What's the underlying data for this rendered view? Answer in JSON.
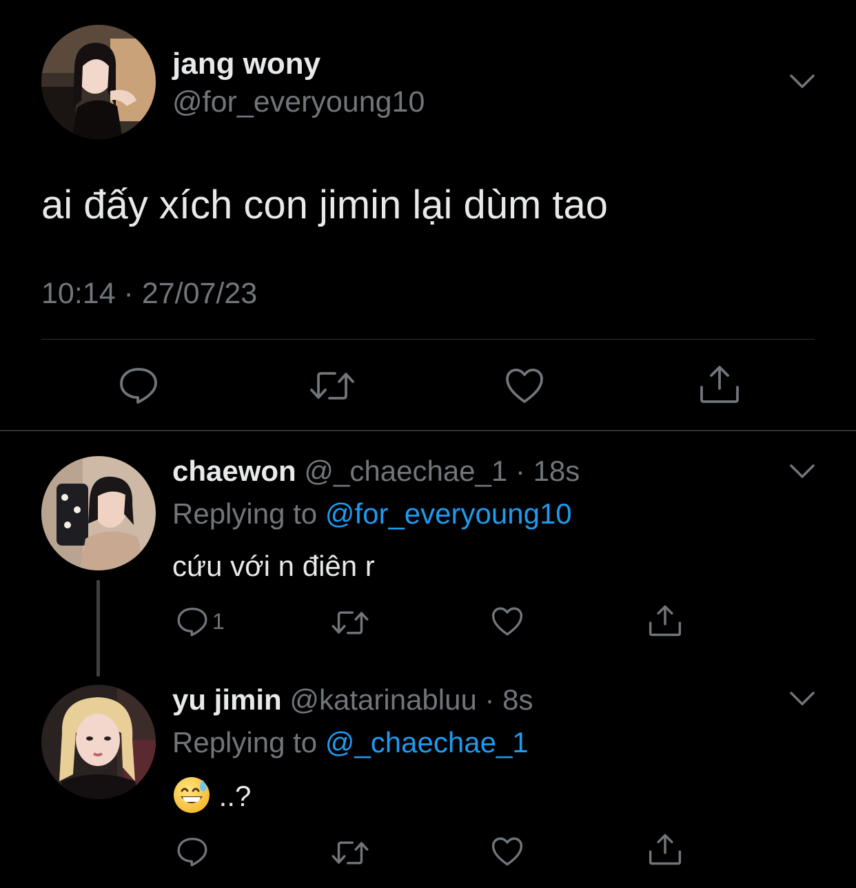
{
  "colors": {
    "background": "#000000",
    "primary_text": "#e7e9ea",
    "secondary_text": "#71767b",
    "mention": "#1d9bf0",
    "divider": "#2f3336"
  },
  "main_tweet": {
    "display_name": "jang wony",
    "handle": "@for_everyoung10",
    "text": "ai đấy xích con jimin lại dùm tao",
    "timestamp": "10:14 · 27/07/23",
    "actions": [
      {
        "icon": "reply-icon"
      },
      {
        "icon": "retweet-icon"
      },
      {
        "icon": "like-icon"
      },
      {
        "icon": "share-icon"
      }
    ]
  },
  "replies": [
    {
      "display_name": "chaewon",
      "meta": "@_chaechae_1 · 18s",
      "replying_prefix": "Replying to",
      "replying_to": "@for_everyoung10",
      "text": "cứu với n điên r",
      "reply_count": "1"
    },
    {
      "display_name": "yu jimin",
      "meta": "@katarinabluu · 8s",
      "replying_prefix": "Replying to",
      "replying_to": "@_chaechae_1",
      "emoji": "grinning-face-with-sweat",
      "text": "..?",
      "reply_count": ""
    }
  ]
}
